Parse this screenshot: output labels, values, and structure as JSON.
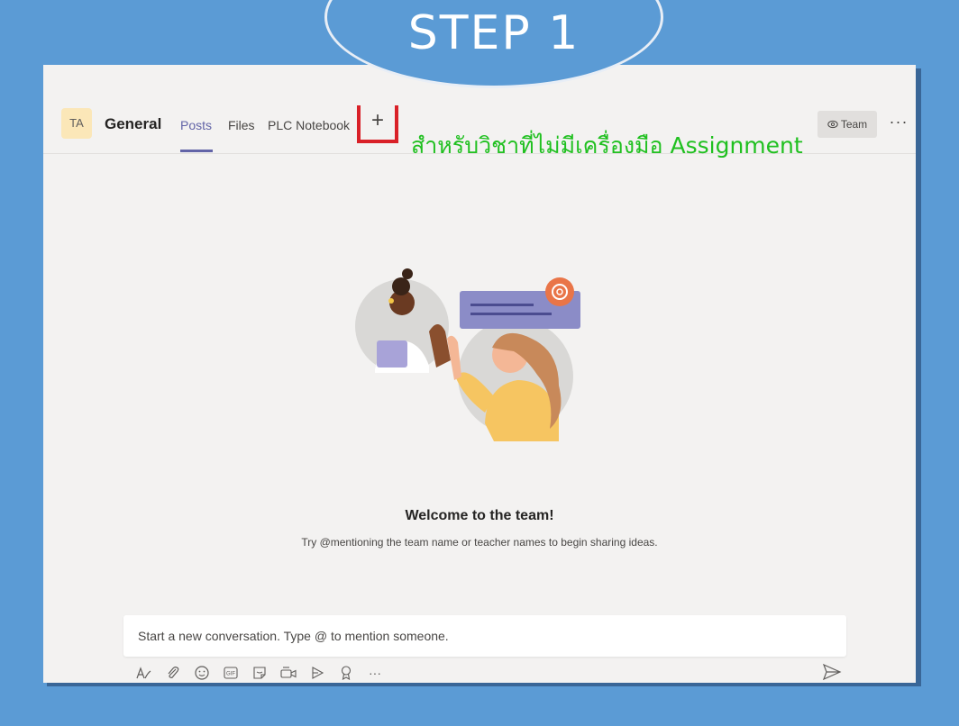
{
  "banner": {
    "text": "STEP 1"
  },
  "header": {
    "team_initials": "TA",
    "channel": "General",
    "tabs": [
      {
        "label": "Posts",
        "active": true
      },
      {
        "label": "Files",
        "active": false
      },
      {
        "label": "PLC Notebook",
        "active": false
      }
    ],
    "add_tab_symbol": "+",
    "team_button": "Team",
    "more_symbol": "···"
  },
  "annotation": "สำหรับวิชาที่ไม่มีเครื่องมือ Assignment",
  "welcome": {
    "title": "Welcome to the team!",
    "subtitle": "Try @mentioning the team name or teacher names to begin sharing ideas."
  },
  "compose": {
    "placeholder": "Start a new conversation. Type @ to mention someone.",
    "tools": [
      "format-icon",
      "attach-icon",
      "emoji-icon",
      "gif-icon",
      "sticker-icon",
      "meet-icon",
      "stream-icon",
      "praise-icon",
      "more-icon"
    ],
    "gif_label": "GIF",
    "more_label": "···"
  },
  "colors": {
    "background": "#5b9bd5",
    "accent": "#6264a7",
    "annotation": "#20c020",
    "highlight_box": "#d92128"
  }
}
